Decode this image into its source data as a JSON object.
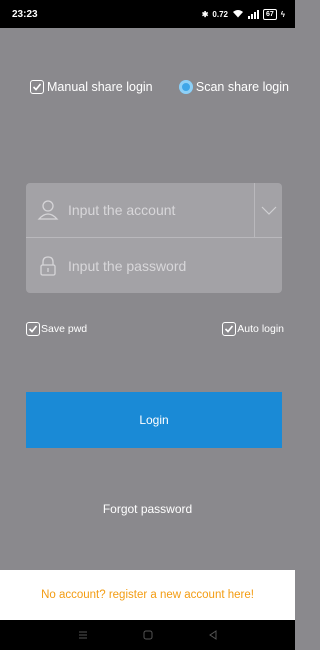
{
  "status_bar": {
    "time": "23:23",
    "network_speed": "0.72",
    "battery": "67"
  },
  "login_mode": {
    "manual_label": "Manual share login",
    "manual_checked": true,
    "scan_label": "Scan share login",
    "scan_selected": true
  },
  "form": {
    "account_placeholder": "Input the account",
    "account_value": "",
    "password_placeholder": "Input the password",
    "password_value": ""
  },
  "options": {
    "save_pwd_label": "Save pwd",
    "save_pwd_checked": true,
    "auto_login_label": "Auto login",
    "auto_login_checked": true
  },
  "actions": {
    "login_label": "Login",
    "forgot_label": "Forgot password",
    "register_label": "No account? register a new account here!"
  },
  "colors": {
    "background": "#8a898d",
    "login_button": "#1a8ad6",
    "register_text": "#f39c12",
    "radio_accent": "#3fa6e8"
  }
}
